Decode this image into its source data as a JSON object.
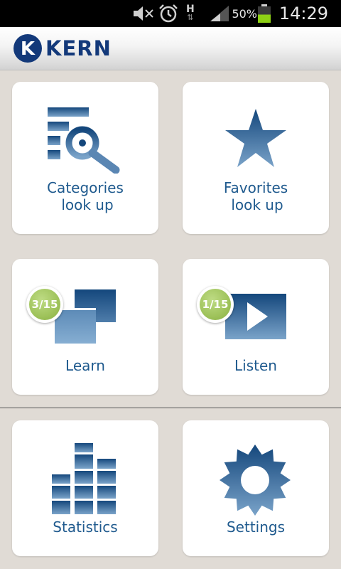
{
  "status_bar": {
    "icons": [
      "mute-icon",
      "alarm-icon",
      "h-plus-data-icon",
      "signal-icon",
      "battery-icon"
    ],
    "network_type": "H",
    "battery_percent": "50%",
    "battery_level": 0.5,
    "battery_color": "#8ed015",
    "time": "14:29"
  },
  "header": {
    "logo_letter": "K",
    "logo_text": "KERN",
    "brand_color": "#13397a"
  },
  "tiles": {
    "categories": {
      "label_line1": "Categories",
      "label_line2": "look up",
      "icon": "search-list-icon"
    },
    "favorites": {
      "label_line1": "Favorites",
      "label_line2": "look up",
      "icon": "star-icon"
    },
    "learn": {
      "label": "Learn",
      "badge": "3/15",
      "icon": "cards-icon"
    },
    "listen": {
      "label": "Listen",
      "badge": "1/15",
      "icon": "play-icon"
    },
    "statistics": {
      "label": "Statistics",
      "icon": "bar-chart-icon"
    },
    "settings": {
      "label": "Settings",
      "icon": "gear-icon"
    }
  },
  "colors": {
    "label_text": "#1f5a8e",
    "icon_dark": "#14477c",
    "icon_light": "#7aa3c9",
    "badge_green": "#9fc35b",
    "background": "#e0dbd5"
  }
}
